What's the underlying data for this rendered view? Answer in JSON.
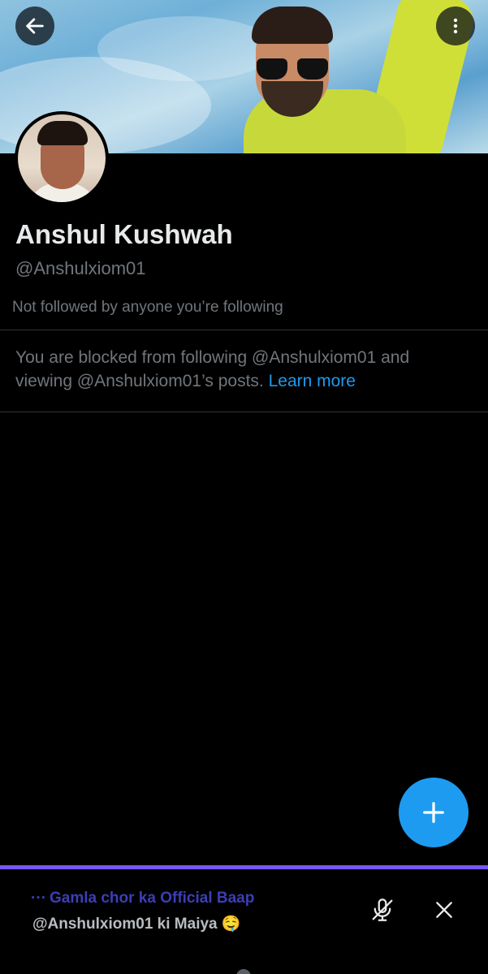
{
  "profile": {
    "name": "Anshul Kushwah",
    "handle": "@Anshulxiom01",
    "followed_by": "Not followed by anyone you’re following"
  },
  "blocked_notice": {
    "text": "You are blocked from following @Anshulxiom01 and viewing @Anshulxiom01’s posts.",
    "link": "Learn more"
  },
  "header": {
    "back_icon": "arrow-left-icon",
    "more_icon": "more-vertical-icon"
  },
  "fab": {
    "icon": "plus-icon"
  },
  "space": {
    "dots": "···",
    "title": "Gamla chor ka Official Baap",
    "subtitle": "@Anshulxiom01 ki Maiya 🤤",
    "mic_icon": "mic-muted-icon",
    "close_icon": "close-icon"
  },
  "colors": {
    "accent": "#1d9bf0",
    "space_bar": "#7856ff",
    "muted_text": "#71767b"
  }
}
